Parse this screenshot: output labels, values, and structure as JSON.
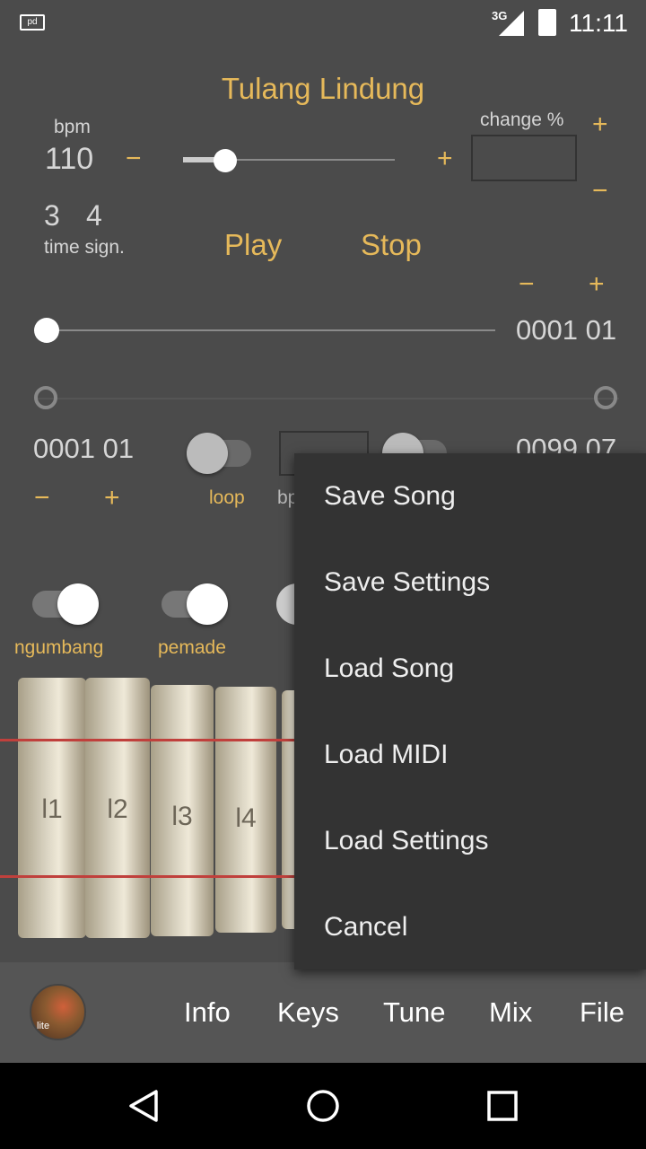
{
  "status": {
    "app_icon": "pd-icon",
    "network": "3G",
    "time": "11:11"
  },
  "title": "Tulang Lindung",
  "tempo": {
    "bpm_label": "bpm",
    "bpm_value": "110",
    "minus": "−",
    "plus": "+",
    "slider_fraction": 0.2
  },
  "change": {
    "label": "change %",
    "value": "",
    "plus": "+",
    "minus": "−"
  },
  "time_signature": {
    "numerator": "3",
    "denominator": "4",
    "label": "time sign."
  },
  "transport": {
    "play": "Play",
    "stop": "Stop"
  },
  "position": {
    "minus": "−",
    "plus": "+",
    "value": "0001 01",
    "slider_fraction": 0.0
  },
  "loop": {
    "start": "0001 01",
    "end": "0099 07",
    "start_minus": "−",
    "start_plus": "+",
    "loop_label": "loop",
    "bpm_label_partial": "bp"
  },
  "instruments": [
    {
      "label": "ngumbang",
      "on": true
    },
    {
      "label": "pemade",
      "on": true
    }
  ],
  "keys": [
    "l1",
    "l2",
    "l3",
    "l4"
  ],
  "menu": [
    "Save Song",
    "Save Settings",
    "Load Song",
    "Load MIDI",
    "Load Settings",
    "Cancel"
  ],
  "bottom_tabs": [
    "Info",
    "Keys",
    "Tune",
    "Mix",
    "File"
  ],
  "logo_text": "lite",
  "colors": {
    "accent": "#e6b95a",
    "background": "#4b4b4b",
    "menu": "#333333"
  }
}
